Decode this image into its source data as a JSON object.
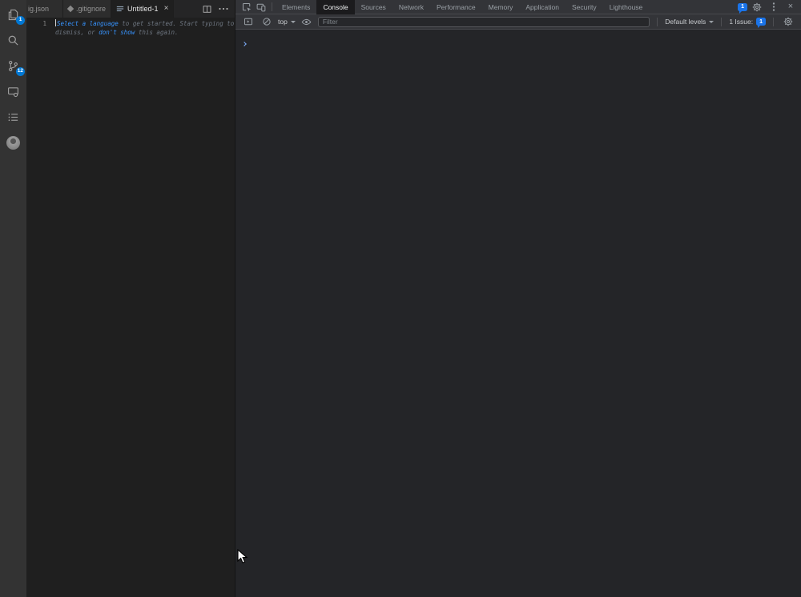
{
  "vscode": {
    "activity_bar": {
      "items": [
        {
          "name": "explorer",
          "badge": "1"
        },
        {
          "name": "search",
          "badge": ""
        },
        {
          "name": "source-control",
          "badge": "12"
        },
        {
          "name": "remote-explorer",
          "badge": ""
        },
        {
          "name": "list-view",
          "badge": ""
        },
        {
          "name": "account-avatar",
          "badge": ""
        }
      ]
    },
    "tabs": [
      {
        "label": "ig.json"
      },
      {
        "label": ".gitignore"
      },
      {
        "label": "Untitled-1"
      }
    ],
    "tab_close_glyph": "×",
    "editor": {
      "line_number": "1",
      "hint_link_1": "Select a language",
      "hint_text_1": " to get started. Start typing to",
      "hint_text_2": "dismiss, or ",
      "hint_link_2": "don't show",
      "hint_text_3": " this again."
    }
  },
  "devtools": {
    "tabs": [
      "Elements",
      "Console",
      "Sources",
      "Network",
      "Performance",
      "Memory",
      "Application",
      "Security",
      "Lighthouse"
    ],
    "active_tab": "Console",
    "header_badge_count": "1",
    "toolbar": {
      "context_selector": "top",
      "filter_placeholder": "Filter",
      "levels_label": "Default levels",
      "issues_text": "1 Issue:",
      "issues_count": "1"
    }
  },
  "icons": {
    "explorer": "stacked-files",
    "search": "magnifier",
    "source_control": "git-branch",
    "remote_explorer": "monitor-with-dot",
    "list_view": "bulleted-list",
    "inspect": "cursor-in-box",
    "device_toolbar": "phone-over-laptop",
    "console_sidebar": "panel-with-play",
    "clear_console": "circle-slash",
    "live_expression": "eye",
    "settings": "gear",
    "more": "kebab-dots",
    "close": "x"
  },
  "colors": {
    "vscode_badge_blue": "#0078d4",
    "vscode_link_blue": "#3794ff",
    "devtools_badge_blue": "#1a73e8",
    "devtools_prompt_blue": "#7cacf8"
  }
}
